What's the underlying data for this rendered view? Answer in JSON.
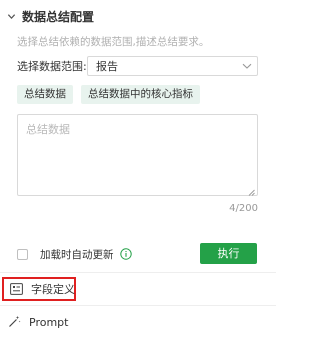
{
  "section": {
    "title": "数据总结配置",
    "hint": "选择总结依赖的数据范围,描述总结要求。"
  },
  "scope": {
    "label": "选择数据范围:",
    "value": "报告"
  },
  "tags": [
    {
      "label": "总结数据"
    },
    {
      "label": "总结数据中的核心指标"
    }
  ],
  "summary": {
    "placeholder": "总结数据",
    "counter": "4/200"
  },
  "auto_update": {
    "label": "加载时自动更新",
    "checked": false
  },
  "execute_label": "执行",
  "bottom": {
    "field_def_label": "字段定义",
    "prompt_label": "Prompt"
  },
  "colors": {
    "accent": "#24a148",
    "tag_bg": "#e8f3ee",
    "highlight": "#e02020"
  }
}
